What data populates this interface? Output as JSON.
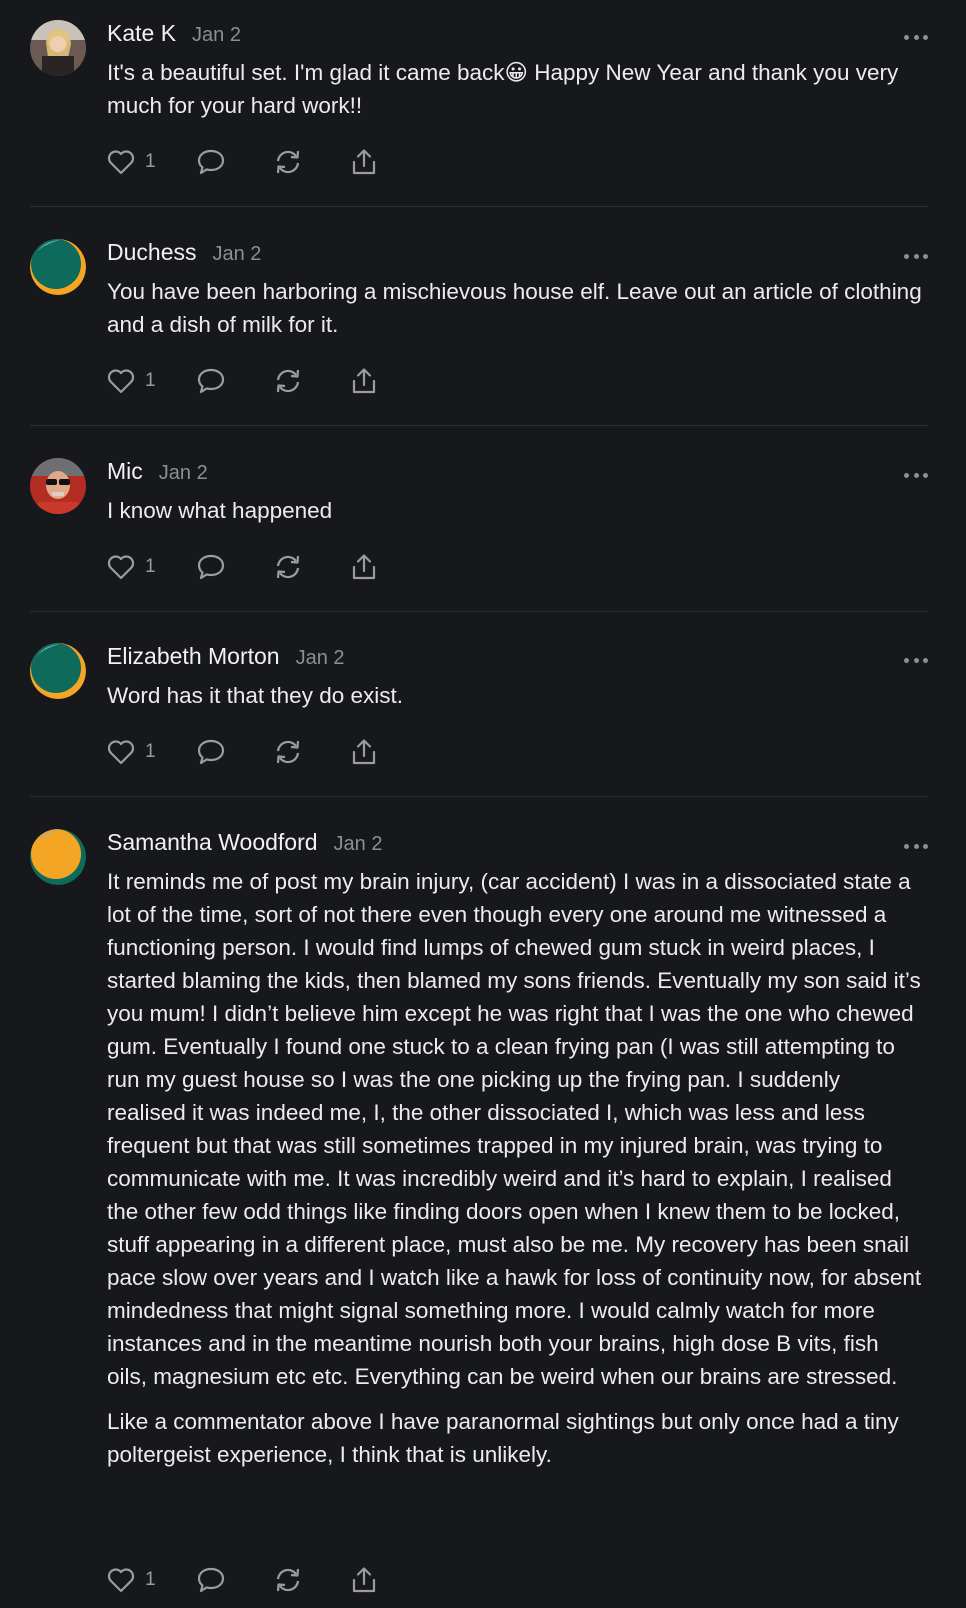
{
  "comments": [
    {
      "author": "Kate K",
      "date": "Jan 2",
      "paragraphs": [
        "It's a beautiful set. I'm glad it came back😀 Happy New Year and thank you very much for your hard work!!"
      ],
      "likes": "1",
      "avatar_icon": "photo-avatar-woman"
    },
    {
      "author": "Duchess",
      "date": "Jan 2",
      "paragraphs": [
        "You have been harboring a mischievous house elf. Leave out an article of clothing and a dish of milk for it."
      ],
      "likes": "1",
      "avatar_icon": "default-avatar-teal"
    },
    {
      "author": "Mic",
      "date": "Jan 2",
      "paragraphs": [
        "I know what happened"
      ],
      "likes": "1",
      "avatar_icon": "photo-avatar-man-sunglasses"
    },
    {
      "author": "Elizabeth Morton",
      "date": "Jan 2",
      "paragraphs": [
        "Word has it that they do exist."
      ],
      "likes": "1",
      "avatar_icon": "default-avatar-teal"
    },
    {
      "author": "Samantha Woodford",
      "date": "Jan 2",
      "paragraphs": [
        "It reminds me of post my brain injury, (car accident) I was in a dissociated state a lot of the time, sort of not there even though every one around me witnessed a functioning person. I would find lumps of chewed gum stuck in weird places, I started blaming the kids, then blamed my sons friends. Eventually my son said it’s you mum! I didn’t believe him except he was right that I was the one who chewed gum. Eventually I found one stuck to a clean frying pan (I was still attempting to run my guest house so I was the one picking up the frying pan. I suddenly realised it was indeed me, I, the other dissociated I, which was less and less frequent but that was still sometimes trapped in my injured brain, was trying to communicate with me. It was incredibly weird and it’s hard to explain, I realised the other few odd things like finding doors open when I knew them to be locked, stuff appearing in a different place, must also be me. My recovery has been snail pace slow over years and I watch like a hawk for loss of continuity now, for absent mindedness that might signal something more. I would calmly watch for more instances and in the meantime nourish both your brains, high dose B vits, fish oils, magnesium etc etc. Everything can be weird when our brains are stressed.",
        "Like a commentator above I have paranormal sightings but only once had a tiny poltergeist experience, I think that is unlikely."
      ],
      "likes": "1",
      "avatar_icon": "default-avatar-orange"
    }
  ],
  "colors": {
    "background": "#17181b",
    "text": "#ececec",
    "muted": "#8c8e93",
    "divider": "#2c2e32",
    "avatar_teal": "#0e6b5c",
    "avatar_orange": "#f5a524"
  },
  "action_icons": [
    "heart-icon",
    "comment-icon",
    "restack-icon",
    "share-icon"
  ]
}
